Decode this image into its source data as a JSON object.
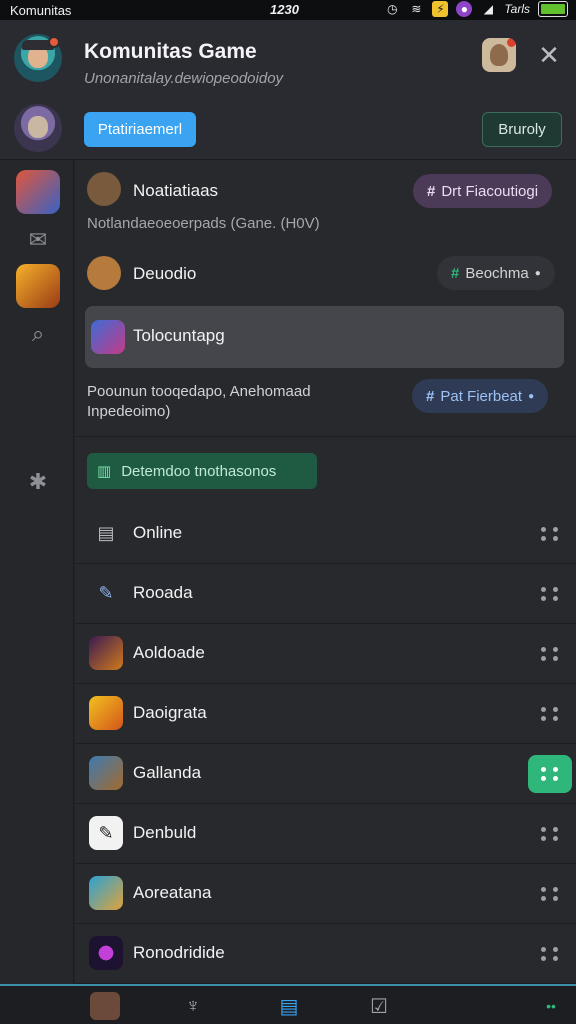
{
  "status_bar": {
    "carrier": "Komunitas",
    "time": "1230",
    "right_text": "Tarls"
  },
  "header": {
    "title": "Komunitas Game",
    "subtitle": "Unonanitalay.dewiopeodoidoy",
    "primary_button": "Ptatiriaemerl",
    "secondary_button": "Bruroly"
  },
  "main": {
    "top_items": [
      {
        "label": "Noatiatiaas",
        "pill": "Drt Fiacoutiogi",
        "pill_color": "#4b3a58"
      },
      {
        "label": "Deuodio",
        "pill": "Beochma",
        "pill_color": "#323338"
      },
      {
        "label": "Tolocuntapg"
      }
    ],
    "description": "Notlandaeoeoerpads (Gane. (H0V)",
    "note": {
      "line1": "Poounun tooqedapo, Anehomaad",
      "line2": "Inpedeoimo)",
      "pill": "Pat Fierbeat"
    },
    "green_tag": "Detemdoo tnothasonos",
    "list": [
      {
        "label": "Online",
        "icon": "calendar-icon",
        "active": false
      },
      {
        "label": "Rooada",
        "icon": "pen-icon",
        "active": false
      },
      {
        "label": "Aoldoade",
        "icon": "game-icon",
        "active": false
      },
      {
        "label": "Daoigrata",
        "icon": "game-icon",
        "active": false
      },
      {
        "label": "Gallanda",
        "icon": "game-icon",
        "active": true
      },
      {
        "label": "Denbuld",
        "icon": "book-icon",
        "active": false
      },
      {
        "label": "Aoreatana",
        "icon": "game-icon",
        "active": false
      },
      {
        "label": "Ronodridide",
        "icon": "game-icon",
        "active": false
      }
    ]
  },
  "colors": {
    "accent_blue": "#3aa3f2",
    "accent_green": "#2fb67a",
    "background": "#28292d"
  }
}
